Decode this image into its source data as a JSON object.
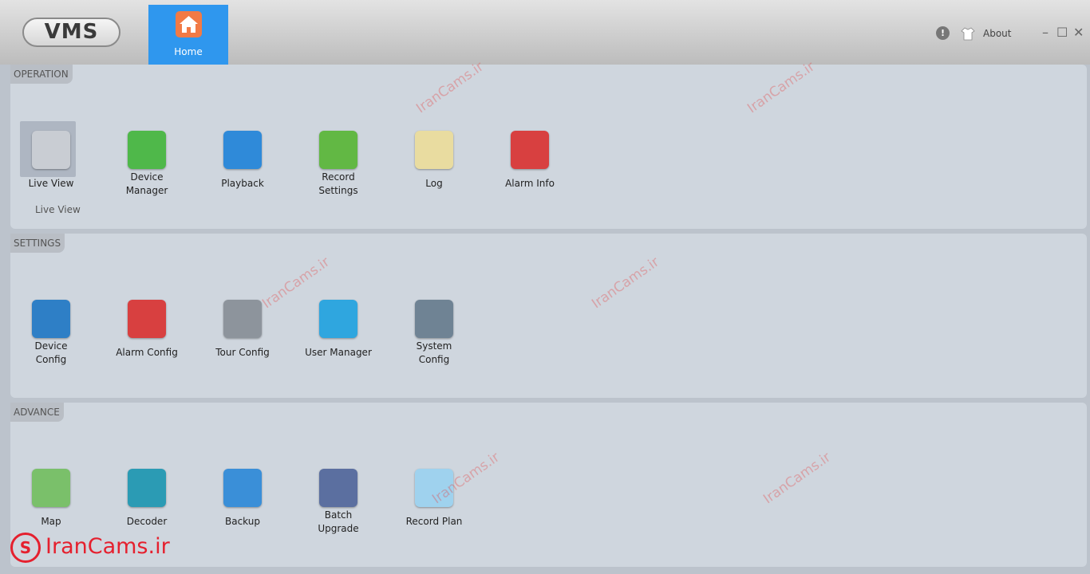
{
  "app": {
    "logo_text": "VMS",
    "home_tab": "Home",
    "about": "About",
    "window": {
      "minimize": "–",
      "maximize": "☐",
      "close": "✕"
    },
    "info_glyph": "!"
  },
  "operation": {
    "tag": "OPERATION",
    "sub_label": "Live View",
    "items": [
      {
        "label": "Live View",
        "icon": "live-view-camera-icon",
        "color": "#c9cdd3"
      },
      {
        "label": "Device\nManager",
        "icon": "device-manager-icon",
        "color": "#4fb84a"
      },
      {
        "label": "Playback",
        "icon": "playback-clapper-icon",
        "color": "#2f8ad9"
      },
      {
        "label": "Record\nSettings",
        "icon": "record-settings-icon",
        "color": "#62b844"
      },
      {
        "label": "Log",
        "icon": "log-icon",
        "color": "#e9dca0"
      },
      {
        "label": "Alarm Info",
        "icon": "alarm-shield-icon",
        "color": "#d84040"
      }
    ]
  },
  "settings": {
    "tag": "SETTINGS",
    "items": [
      {
        "label": "Device\nConfig",
        "icon": "device-config-icon",
        "color": "#2e7fc6"
      },
      {
        "label": "Alarm Config",
        "icon": "alarm-config-icon",
        "color": "#d84040"
      },
      {
        "label": "Tour Config",
        "icon": "tour-config-icon",
        "color": "#8d949c"
      },
      {
        "label": "User Manager",
        "icon": "user-manager-icon",
        "color": "#2fa6df"
      },
      {
        "label": "System\nConfig",
        "icon": "system-config-gear-icon",
        "color": "#6f8394"
      }
    ]
  },
  "advance": {
    "tag": "ADVANCE",
    "items": [
      {
        "label": "Map",
        "icon": "map-icon",
        "color": "#7ac06a"
      },
      {
        "label": "Decoder",
        "icon": "decoder-icon",
        "color": "#2b9bb4"
      },
      {
        "label": "Backup",
        "icon": "backup-icon",
        "color": "#3a8fd8"
      },
      {
        "label": "Batch\nUpgrade",
        "icon": "batch-upgrade-arrow-icon",
        "color": "#5b6fa0"
      },
      {
        "label": "Record Plan",
        "icon": "record-plan-disc-icon",
        "color": "#9fd2ee"
      }
    ]
  },
  "watermark": {
    "text": "IranCams.ir",
    "brand_glyph": "S"
  }
}
